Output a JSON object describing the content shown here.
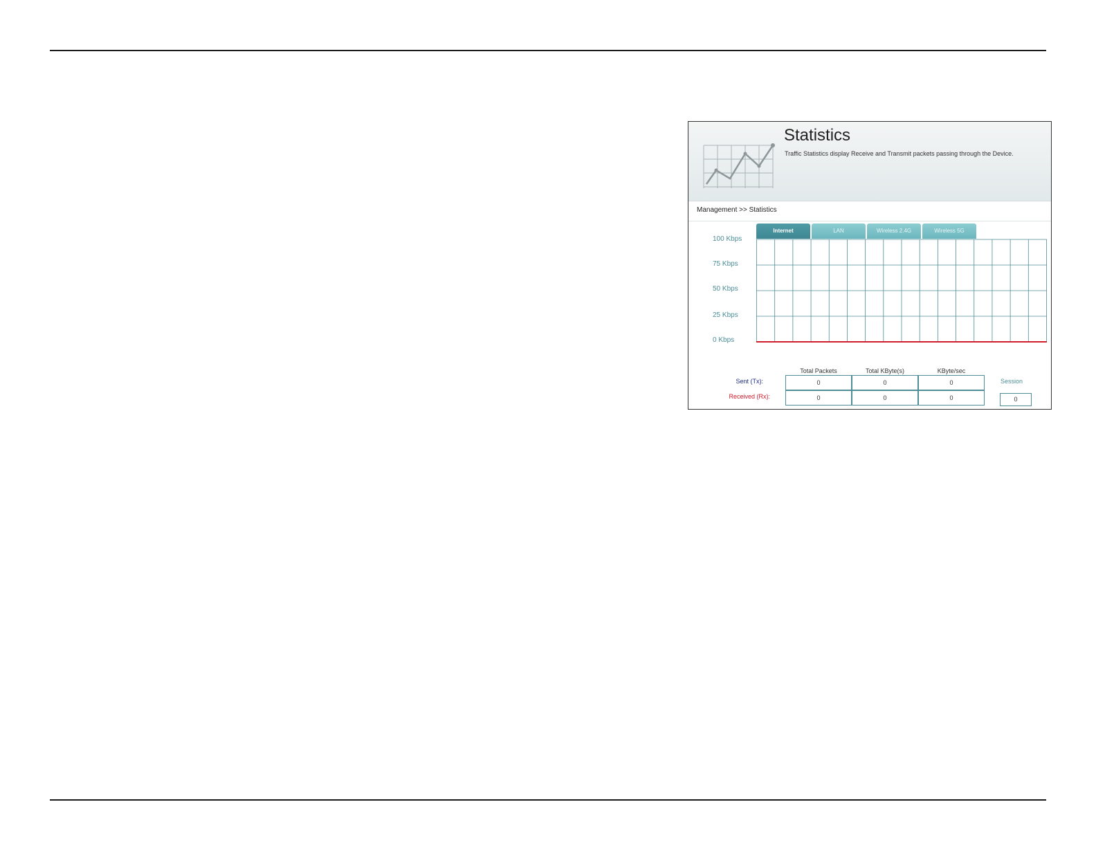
{
  "page": {
    "title": "Statistics",
    "description": "Traffic Statistics display Receive and Transmit packets passing through the Device.",
    "breadcrumb": "Management >> Statistics"
  },
  "tabs": [
    {
      "label": "Internet",
      "active": true
    },
    {
      "label": "LAN",
      "active": false
    },
    {
      "label": "Wireless 2.4G",
      "active": false
    },
    {
      "label": "Wireless 5G",
      "active": false
    }
  ],
  "chart_data": {
    "type": "line",
    "y_tick_labels": [
      "100 Kbps",
      "75 Kbps",
      "50 Kbps",
      "25 Kbps",
      "0 Kbps"
    ],
    "ylim": [
      0,
      100
    ],
    "grid": true,
    "series": [
      {
        "values": [
          0,
          0,
          0,
          0,
          0,
          0,
          0,
          0,
          0,
          0,
          0,
          0,
          0,
          0,
          0,
          0,
          0
        ],
        "color": "#d11a2a"
      }
    ]
  },
  "stats": {
    "columns": [
      "Total Packets",
      "Total KByte(s)",
      "KByte/sec"
    ],
    "sent": {
      "label": "Sent (Tx):",
      "values": [
        "0",
        "0",
        "0"
      ]
    },
    "received": {
      "label": "Received (Rx):",
      "values": [
        "0",
        "0",
        "0"
      ]
    },
    "session_label": "Session",
    "session_value": "0"
  },
  "colors": {
    "accent": "#4c8d97",
    "tab": "#6cb6be",
    "tab_active": "#3e8793",
    "sent": "#1d2b8c",
    "received": "#d11a2a"
  }
}
